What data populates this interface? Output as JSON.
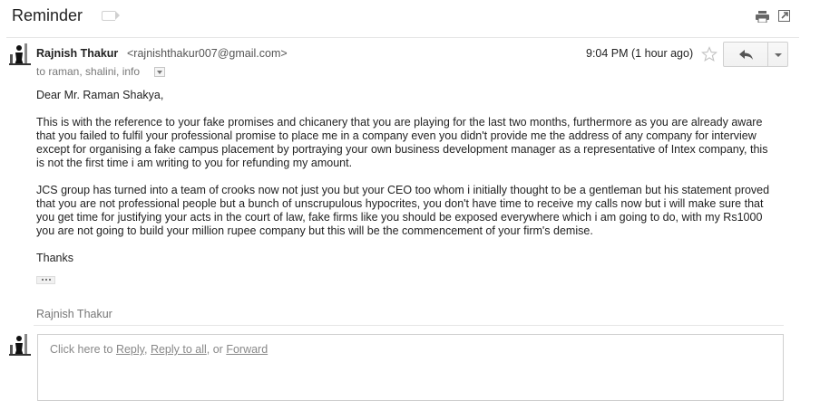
{
  "subject": "Reminder",
  "toolbar": {
    "print_icon": "print-icon",
    "popout_icon": "open-in-new-window-icon"
  },
  "message": {
    "sender_name": "Rajnish Thakur",
    "sender_email": "<rajnishthakur007@gmail.com>",
    "recipients": "to raman, shalini, info",
    "time": "9:04 PM (1 hour ago)",
    "greeting": "Dear Mr. Raman Shakya,",
    "paragraph_1": "This is with the reference to your fake promises and chicanery that you are playing for the last two months, furthermore as you are already aware that you failed to fulfil your professional promise to place me in a company even you didn't provide me the address of any company for interview except for organising a fake campus placement by portraying your own business development manager as a representative of Intex company, this is not the first time i am writing to you for refunding my amount.",
    "paragraph_2": "JCS group has turned into a team of crooks now not just you but your CEO too whom i initially thought to be a gentleman but his statement proved that you are not professional people but a bunch of unscrupulous hypocrites, you don't have time to receive my calls now but i will make sure that you get time for justifying your acts in the court of law, fake firms like you should be exposed everywhere which i am going to do, with my Rs1000 you are not going to build your million rupee company but this will be the commencement of your firm's demise.",
    "closing": "Thanks"
  },
  "signature_name": "Rajnish Thakur",
  "reply_box": {
    "prefix": "Click here to ",
    "reply": "Reply",
    "sep1": ", ",
    "reply_all": "Reply to all",
    "sep2": ", or ",
    "forward": "Forward"
  },
  "colors": {
    "text": "#222222",
    "muted": "#777777",
    "border": "#e5e5e5"
  }
}
